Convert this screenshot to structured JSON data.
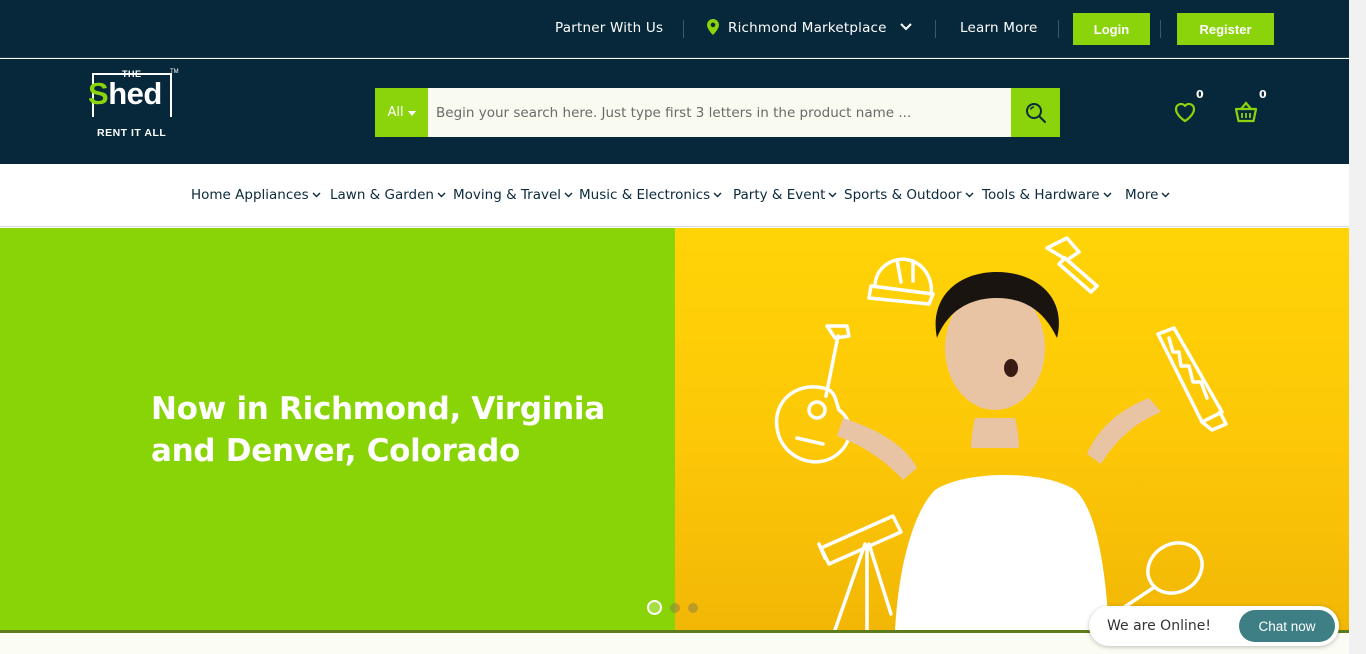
{
  "topbar": {
    "partner": "Partner With Us",
    "location": "Richmond Marketplace",
    "learn_more": "Learn More",
    "login": "Login",
    "register": "Register"
  },
  "logo": {
    "the": "THE",
    "name_s": "S",
    "name_rest": "hed",
    "tm": "TM",
    "tagline": "RENT IT ALL"
  },
  "search": {
    "category": "All",
    "placeholder": "Begin your search here. Just type first 3 letters in the product name ..."
  },
  "header_icons": {
    "wishlist_count": "0",
    "cart_count": "0"
  },
  "categories": [
    "Home Appliances",
    "Lawn & Garden",
    "Moving & Travel",
    "Music & Electronics",
    "Party & Event",
    "Sports & Outdoor",
    "Tools & Hardware",
    "More"
  ],
  "hero": {
    "title": "Now in Richmond, Virginia and Denver, Colorado",
    "slide_count": 3,
    "active_slide": 1
  },
  "chat": {
    "status": "We are Online!",
    "button": "Chat now"
  },
  "colors": {
    "navy": "#06283a",
    "brand_green": "#8bd30b",
    "hero_yellow": "#ffd407",
    "chat_teal": "#3d7f84"
  }
}
